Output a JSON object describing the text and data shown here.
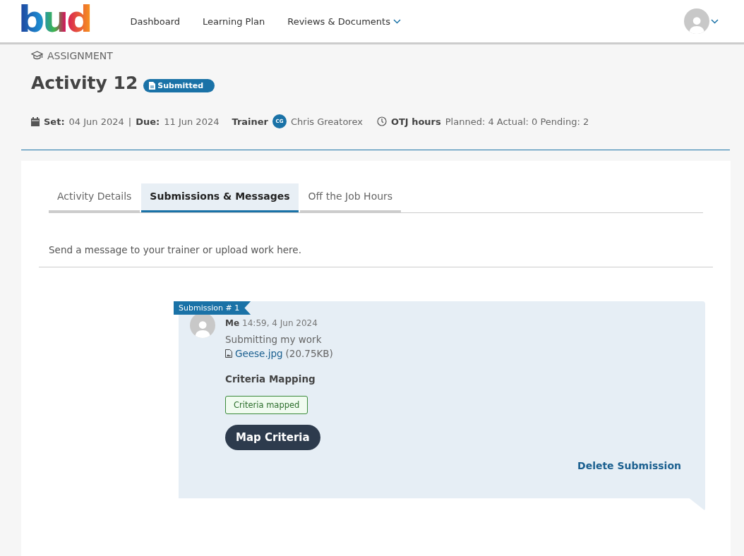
{
  "logo": "bud",
  "nav": [
    {
      "label": "Dashboard",
      "dropdown": false
    },
    {
      "label": "Learning Plan",
      "dropdown": false
    },
    {
      "label": "Reviews & Documents",
      "dropdown": true
    }
  ],
  "section": "ASSIGNMENT",
  "title": "Activity 12",
  "status": "Submitted",
  "meta": {
    "set_label": "Set:",
    "set": "04 Jun 2024",
    "separator": "|",
    "due_label": "Due:",
    "due": "11 Jun 2024",
    "trainer_label": "Trainer",
    "trainer_initials": "CG",
    "trainer": "Chris Greatorex",
    "otj_label": "OTJ hours",
    "otj": "Planned: 4 Actual: 0 Pending: 2"
  },
  "tabs": [
    {
      "label": "Activity Details",
      "selected": false
    },
    {
      "label": "Submissions & Messages",
      "selected": true
    },
    {
      "label": "Off the Job Hours",
      "selected": false
    }
  ],
  "intro": "Send a message to your trainer or upload work here.",
  "submission": {
    "ribbon": "Submission # 1",
    "author": "Me",
    "time": "14:59, 4 Jun 2024",
    "message": "Submitting my work",
    "file": "Geese.jpg",
    "size": "(20.75KB)",
    "mapping_heading": "Criteria Mapping",
    "mapping_status": "Criteria mapped",
    "map_button": "Map Criteria",
    "delete": "Delete Submission"
  }
}
